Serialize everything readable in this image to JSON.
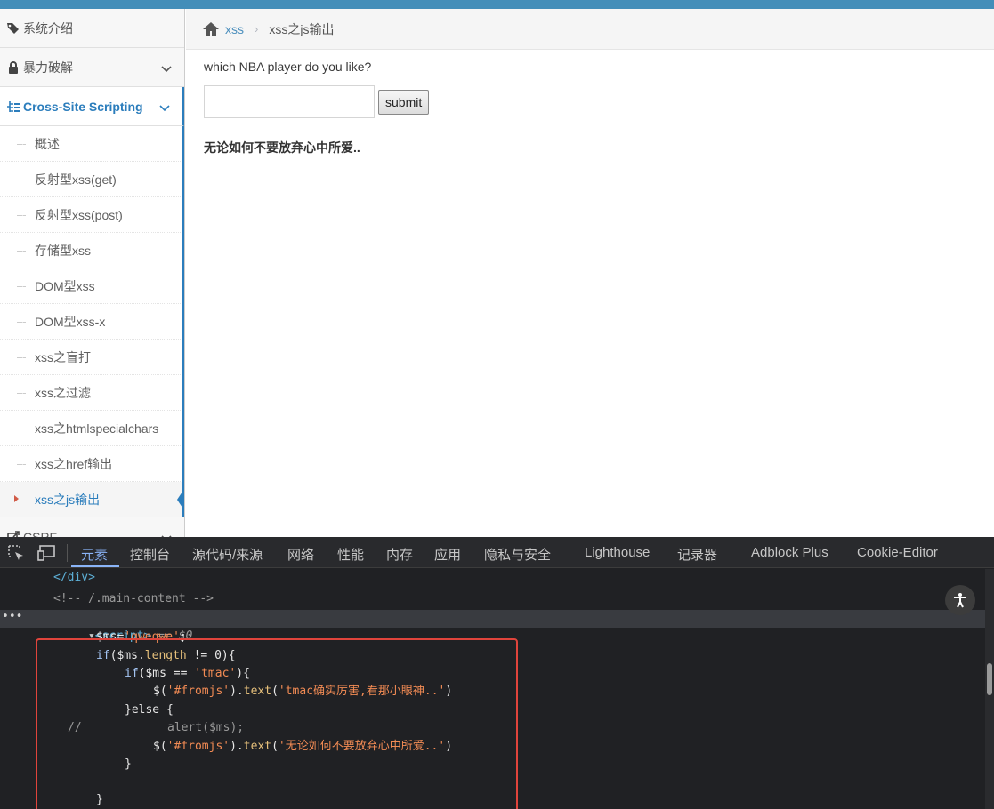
{
  "sidebar": {
    "items": [
      {
        "label": "系统介绍",
        "icon": "tags-icon"
      },
      {
        "label": "暴力破解",
        "icon": "lock-icon"
      },
      {
        "label": "Cross-Site Scripting",
        "icon": "tree-icon"
      }
    ],
    "xss_sub": [
      "概述",
      "反射型xss(get)",
      "反射型xss(post)",
      "存储型xss",
      "DOM型xss",
      "DOM型xss-x",
      "xss之盲打",
      "xss之过滤",
      "xss之htmlspecialchars",
      "xss之href输出",
      "xss之js输出"
    ],
    "next_item": "CSRF"
  },
  "breadcrumb": {
    "parent": "xss",
    "current": "xss之js输出"
  },
  "main": {
    "question": "which NBA player do you like?",
    "input_value": "",
    "submit_label": "submit",
    "result_text": "无论如何不要放弃心中所爱.."
  },
  "devtools": {
    "tabs": [
      "元素",
      "控制台",
      "源代码/来源",
      "网络",
      "性能",
      "内存",
      "应用",
      "隐私与安全",
      "Lighthouse",
      "记录器",
      "Adblock Plus",
      "Cookie-Editor"
    ],
    "active_tab": "元素",
    "code": {
      "l1": "</div>",
      "l2": "<!-- /.main-content -->",
      "l3_tag": "<script>",
      "l3_suffix": "== $0",
      "l4_a": "$ms=",
      "l4_b": "'qweqwe'",
      "l4_c": ";",
      "l5_a": "if",
      "l5_b": "($ms.",
      "l5_c": "length",
      "l5_d": " != 0){",
      "l6_a": "if",
      "l6_b": "($ms == ",
      "l6_c": "'tmac'",
      "l6_d": "){",
      "l7_a": "$(",
      "l7_b": "'#fromjs'",
      "l7_c": ").",
      "l7_d": "text",
      "l7_e": "(",
      "l7_f": "'tmac确实厉害,看那小眼神..'",
      "l7_g": ")",
      "l8": "}else {",
      "l9_a": "//",
      "l9_b": "alert($ms);",
      "l10_a": "$(",
      "l10_b": "'#fromjs'",
      "l10_c": ").",
      "l10_d": "text",
      "l10_e": "(",
      "l10_f": "'无论如何不要放弃心中所爱..'",
      "l10_g": ")",
      "l11": "}",
      "l13": "}"
    }
  },
  "colors": {
    "topbar": "#438eb9",
    "accent": "#2b7dbc",
    "highlight_box": "#e0443c"
  }
}
